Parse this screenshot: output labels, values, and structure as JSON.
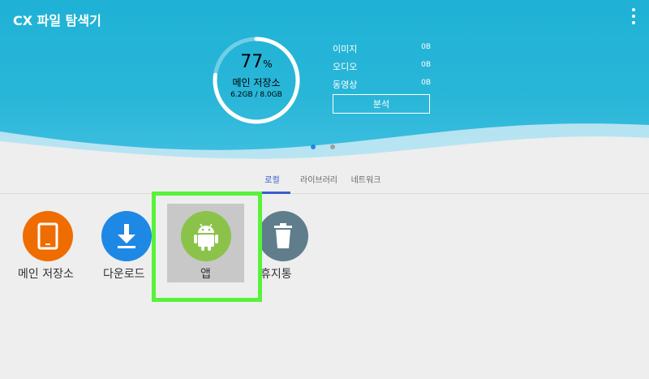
{
  "app": {
    "title": "CX 파일 탐색기"
  },
  "storage": {
    "percent": "77",
    "percent_sign": "%",
    "percent_value": 77,
    "label": "메인 저장소",
    "size": "6.2GB / 8.0GB"
  },
  "stats": [
    {
      "label": "이미지",
      "value": "0B"
    },
    {
      "label": "오디오",
      "value": "0B"
    },
    {
      "label": "동영상",
      "value": "0B"
    }
  ],
  "analyze_label": "분석",
  "tabs": [
    {
      "label": "로컬",
      "active": true
    },
    {
      "label": "라이브러리",
      "active": false
    },
    {
      "label": "네트워크",
      "active": false
    }
  ],
  "tiles": [
    {
      "label": "메인 저장소",
      "icon": "tablet-icon",
      "color": "#ef6c00"
    },
    {
      "label": "다운로드",
      "icon": "download-icon",
      "color": "#1e88e5"
    },
    {
      "label": "앱",
      "icon": "android-icon",
      "color": "#8bc34a"
    },
    {
      "label": "휴지통",
      "icon": "trash-icon",
      "color": "#607d8b"
    }
  ],
  "colors": {
    "header": "#29b6d8",
    "highlight_frame": "#59f23a",
    "active_tab": "#3a5ec9"
  }
}
